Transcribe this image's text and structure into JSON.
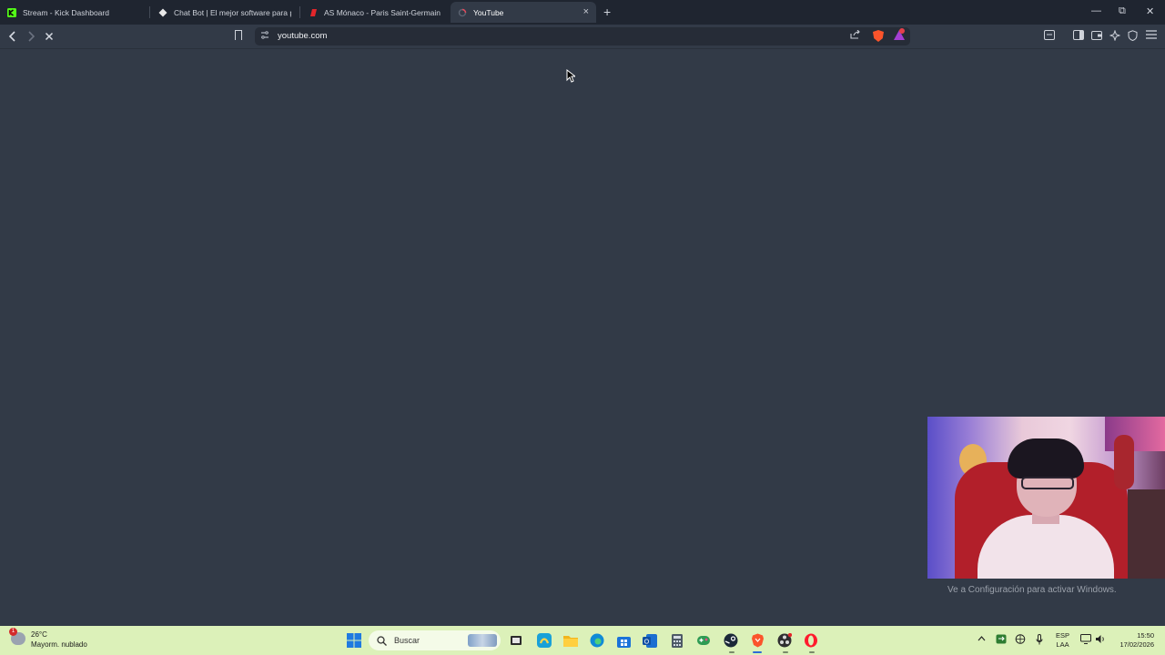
{
  "browser": {
    "tabs": [
      {
        "title": "Stream - Kick Dashboard",
        "favicon": "kick-icon",
        "active": false
      },
      {
        "title": "Chat Bot | El mejor software para po",
        "favicon": "botrix-icon",
        "active": false
      },
      {
        "title": "AS Mónaco - Paris Saint-Germain Cu",
        "favicon": "as-icon",
        "active": false
      },
      {
        "title": "YouTube",
        "favicon": "youtube-icon",
        "active": true
      }
    ],
    "tab_close": "×",
    "new_tab": "+",
    "window_controls": {
      "minimize": "—",
      "restore": "⧉",
      "close": "✕"
    },
    "toolbar": {
      "back": "‹",
      "forward": "›",
      "stop": "✕",
      "url": "youtube.com",
      "rewards_badge": "1"
    }
  },
  "page": {
    "state": "loading",
    "background": "#323a47"
  },
  "overlay": {
    "watermark": "Ve a Configuración para activar Windows."
  },
  "taskbar": {
    "weather": {
      "temp": "26°C",
      "desc": "Mayorm. nublado",
      "badge": "1"
    },
    "search_placeholder": "Buscar",
    "language": {
      "line1": "ESP",
      "line2": "LAA"
    },
    "clock": {
      "time": "15:50",
      "date": "17/02/2026"
    },
    "colors": {
      "taskbar_bg": "#dcf1b9",
      "accent": "#2d6bd6"
    }
  }
}
